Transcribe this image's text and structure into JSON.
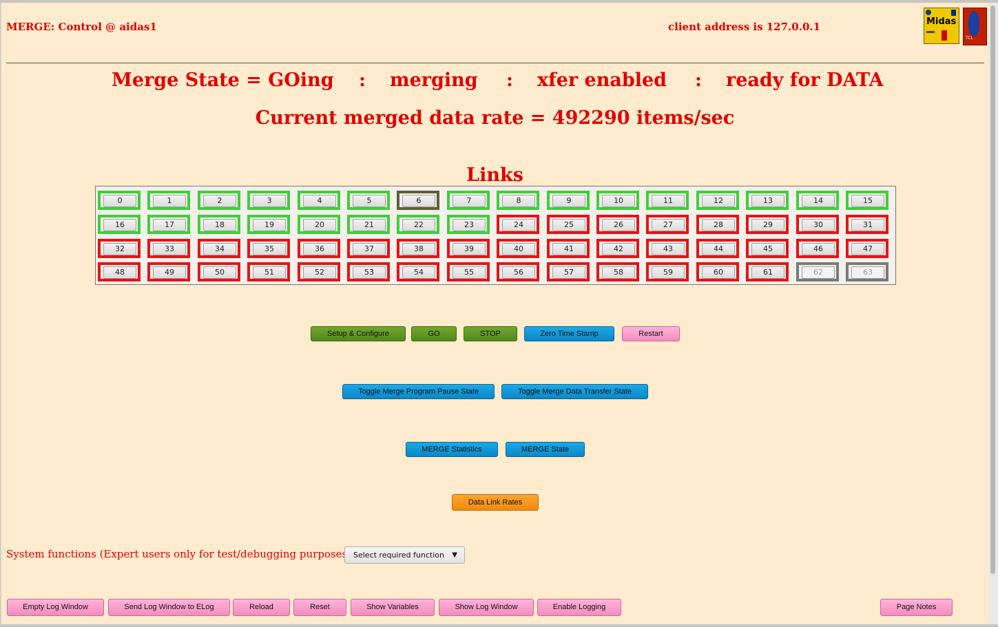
{
  "header": {
    "title": "MERGE: Control @ aidas1",
    "client": "client address is 127.0.0.1",
    "logos": [
      "Midas",
      "TCL"
    ]
  },
  "state_line": {
    "state": "Merge State = GOing",
    "sep": ":",
    "merging": "merging",
    "xfer": "xfer enabled",
    "ready": "ready for DATA"
  },
  "rate_line": "Current merged data rate = 492290 items/sec",
  "links_title": "Links",
  "links": [
    {
      "label": "0",
      "status": "green"
    },
    {
      "label": "1",
      "status": "green"
    },
    {
      "label": "2",
      "status": "green"
    },
    {
      "label": "3",
      "status": "green"
    },
    {
      "label": "4",
      "status": "green"
    },
    {
      "label": "5",
      "status": "green"
    },
    {
      "label": "6",
      "status": "dark"
    },
    {
      "label": "7",
      "status": "green"
    },
    {
      "label": "8",
      "status": "green"
    },
    {
      "label": "9",
      "status": "green"
    },
    {
      "label": "10",
      "status": "green"
    },
    {
      "label": "11",
      "status": "green"
    },
    {
      "label": "12",
      "status": "green"
    },
    {
      "label": "13",
      "status": "green"
    },
    {
      "label": "14",
      "status": "green"
    },
    {
      "label": "15",
      "status": "green"
    },
    {
      "label": "16",
      "status": "green"
    },
    {
      "label": "17",
      "status": "green"
    },
    {
      "label": "18",
      "status": "green"
    },
    {
      "label": "19",
      "status": "green"
    },
    {
      "label": "20",
      "status": "green"
    },
    {
      "label": "21",
      "status": "green"
    },
    {
      "label": "22",
      "status": "green"
    },
    {
      "label": "23",
      "status": "green"
    },
    {
      "label": "24",
      "status": "red"
    },
    {
      "label": "25",
      "status": "red"
    },
    {
      "label": "26",
      "status": "red"
    },
    {
      "label": "27",
      "status": "red"
    },
    {
      "label": "28",
      "status": "red"
    },
    {
      "label": "29",
      "status": "red"
    },
    {
      "label": "30",
      "status": "red"
    },
    {
      "label": "31",
      "status": "red"
    },
    {
      "label": "32",
      "status": "red"
    },
    {
      "label": "33",
      "status": "red"
    },
    {
      "label": "34",
      "status": "red"
    },
    {
      "label": "35",
      "status": "red"
    },
    {
      "label": "36",
      "status": "red"
    },
    {
      "label": "37",
      "status": "red"
    },
    {
      "label": "38",
      "status": "red"
    },
    {
      "label": "39",
      "status": "red"
    },
    {
      "label": "40",
      "status": "red"
    },
    {
      "label": "41",
      "status": "red"
    },
    {
      "label": "42",
      "status": "red"
    },
    {
      "label": "43",
      "status": "red"
    },
    {
      "label": "44",
      "status": "red"
    },
    {
      "label": "45",
      "status": "red"
    },
    {
      "label": "46",
      "status": "red"
    },
    {
      "label": "47",
      "status": "red"
    },
    {
      "label": "48",
      "status": "red"
    },
    {
      "label": "49",
      "status": "red"
    },
    {
      "label": "50",
      "status": "red"
    },
    {
      "label": "51",
      "status": "red"
    },
    {
      "label": "52",
      "status": "red"
    },
    {
      "label": "53",
      "status": "red"
    },
    {
      "label": "54",
      "status": "red"
    },
    {
      "label": "55",
      "status": "red"
    },
    {
      "label": "56",
      "status": "red"
    },
    {
      "label": "57",
      "status": "red"
    },
    {
      "label": "58",
      "status": "red"
    },
    {
      "label": "59",
      "status": "red"
    },
    {
      "label": "60",
      "status": "red"
    },
    {
      "label": "61",
      "status": "red"
    },
    {
      "label": "62",
      "status": "gray"
    },
    {
      "label": "63",
      "status": "gray"
    }
  ],
  "controls": {
    "setup": "Setup & Configure",
    "go": "GO",
    "stop": "STOP",
    "zero": "Zero Time Stamp",
    "restart": "Restart",
    "toggle_pause": "Toggle Merge Program Pause State",
    "toggle_xfer": "Toggle Merge Data Transfer State",
    "stats": "MERGE Statistics",
    "state": "MERGE State",
    "rates": "Data Link Rates"
  },
  "system": {
    "label": "System functions (Expert users only for test/debugging purposes!!!)",
    "select_value": "Select required function"
  },
  "footer": {
    "empty_log": "Empty Log Window",
    "send_log": "Send Log Window to ELog",
    "reload": "Reload",
    "reset": "Reset",
    "show_vars": "Show Variables",
    "show_log": "Show Log Window",
    "enable_log": "Enable Logging",
    "page_notes": "Page Notes"
  },
  "colors": {
    "background": "#ffebcd",
    "text_red": "#e00000",
    "link_ok": "#3fcf3a",
    "link_bad": "#e61414",
    "link_dark": "#5f5f37",
    "link_disabled": "#7a7a7a"
  }
}
